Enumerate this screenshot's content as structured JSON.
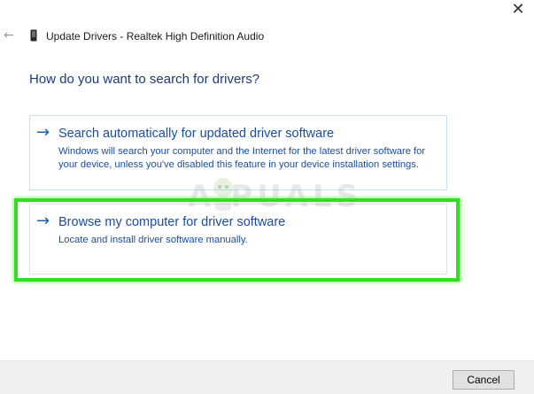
{
  "window": {
    "title": "Update Drivers - Realtek High Definition Audio",
    "close_icon": "close-icon",
    "back_icon": "back-arrow-icon",
    "device_icon": "device-icon"
  },
  "main": {
    "heading": "How do you want to search for drivers?",
    "options": [
      {
        "title": "Search automatically for updated driver software",
        "description": "Windows will search your computer and the Internet for the latest driver software for your device, unless you've disabled this feature in your device installation settings.",
        "icon": "arrow-right-icon"
      },
      {
        "title": "Browse my computer for driver software",
        "description": "Locate and install driver software manually.",
        "icon": "arrow-right-icon"
      }
    ]
  },
  "watermark": {
    "text": "A PUALS"
  },
  "footer": {
    "cancel_label": "Cancel"
  },
  "colors": {
    "heading": "#1e3a78",
    "link": "#1a4d9e",
    "highlight": "#33dd22"
  }
}
